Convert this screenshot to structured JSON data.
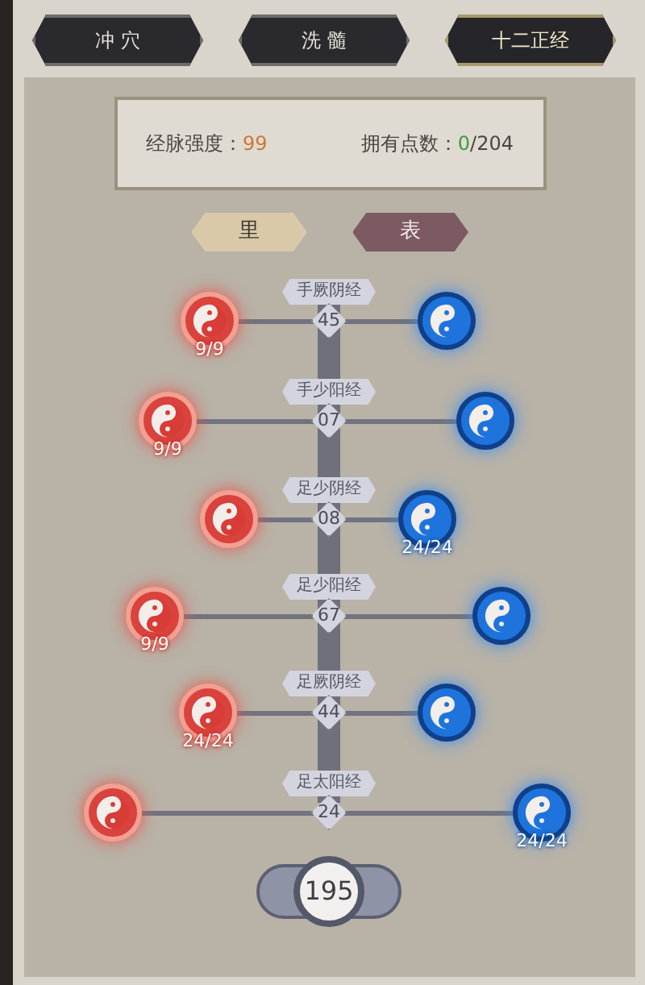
{
  "tabs": [
    {
      "label": "冲 穴",
      "selected": false
    },
    {
      "label": "洗 髓",
      "selected": false
    },
    {
      "label": "十二正经",
      "selected": true
    }
  ],
  "stats": [
    {
      "label": "经脉强度：",
      "value": "99",
      "kind": "strength"
    },
    {
      "label": "拥有点数：",
      "value": "0",
      "total": "/204",
      "kind": "points"
    }
  ],
  "toggles": [
    {
      "label": "里",
      "selected": true
    },
    {
      "label": "表",
      "selected": false
    }
  ],
  "meridians": [
    {
      "name": "手厥阴经",
      "value": "45",
      "yin_count": "9/9"
    },
    {
      "name": "手少阳经",
      "value": "07",
      "yin_count": "9/9"
    },
    {
      "name": "足少阴经",
      "value": "08",
      "yang_count": "24/24"
    },
    {
      "name": "足少阳经",
      "value": "67",
      "yin_count": "9/9"
    },
    {
      "name": "足厥阴经",
      "value": "44",
      "yin_count": "24/24"
    },
    {
      "name": "足太阳经",
      "value": "24",
      "yang_count": "24/24"
    }
  ],
  "total": "195"
}
